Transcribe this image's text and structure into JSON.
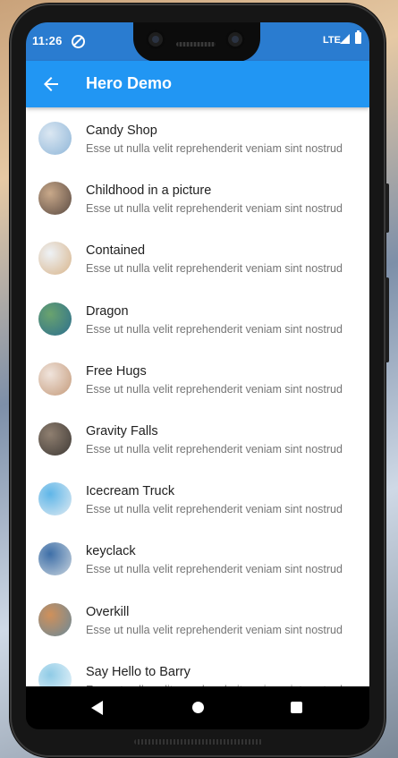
{
  "status_bar": {
    "time": "11:26",
    "network": "LTE"
  },
  "app_bar": {
    "title": "Hero Demo",
    "back_icon": "arrow-back-icon"
  },
  "list": {
    "items": [
      {
        "title": "Candy Shop",
        "subtitle": "Esse ut nulla velit reprehenderit veniam sint nostrud",
        "avatar_colors": [
          "#dbe7f2",
          "#8fb6d8"
        ]
      },
      {
        "title": "Childhood in a picture",
        "subtitle": "Esse ut nulla velit reprehenderit veniam sint nostrud",
        "avatar_colors": [
          "#c9a98a",
          "#5a4a42"
        ]
      },
      {
        "title": "Contained",
        "subtitle": "Esse ut nulla velit reprehenderit veniam sint nostrud",
        "avatar_colors": [
          "#eef2f6",
          "#d8b48a"
        ]
      },
      {
        "title": "Dragon",
        "subtitle": "Esse ut nulla velit reprehenderit veniam sint nostrud",
        "avatar_colors": [
          "#6aa36e",
          "#2c6f8f"
        ]
      },
      {
        "title": "Free Hugs",
        "subtitle": "Esse ut nulla velit reprehenderit veniam sint nostrud",
        "avatar_colors": [
          "#f0e4dc",
          "#c49a7a"
        ]
      },
      {
        "title": "Gravity Falls",
        "subtitle": "Esse ut nulla velit reprehenderit veniam sint nostrud",
        "avatar_colors": [
          "#8f7f70",
          "#3f3a36"
        ]
      },
      {
        "title": "Icecream Truck",
        "subtitle": "Esse ut nulla velit reprehenderit veniam sint nostrud",
        "avatar_colors": [
          "#5fb6e8",
          "#dfeaf2"
        ]
      },
      {
        "title": "keyclack",
        "subtitle": "Esse ut nulla velit reprehenderit veniam sint nostrud",
        "avatar_colors": [
          "#3e6fa8",
          "#c8d4de"
        ]
      },
      {
        "title": "Overkill",
        "subtitle": "Esse ut nulla velit reprehenderit veniam sint nostrud",
        "avatar_colors": [
          "#d0905a",
          "#6a8a9a"
        ]
      },
      {
        "title": "Say Hello to Barry",
        "subtitle": "Esse ut nulla velit reprehenderit veniam sint nostrud",
        "avatar_colors": [
          "#8fcbe6",
          "#eef6fb"
        ]
      }
    ]
  },
  "nav_bar": {
    "back_icon": "nav-back-icon",
    "home_icon": "nav-home-icon",
    "recents_icon": "nav-recents-icon"
  },
  "colors": {
    "app_bar": "#2196f3",
    "status_bar": "#2a7cd0"
  }
}
